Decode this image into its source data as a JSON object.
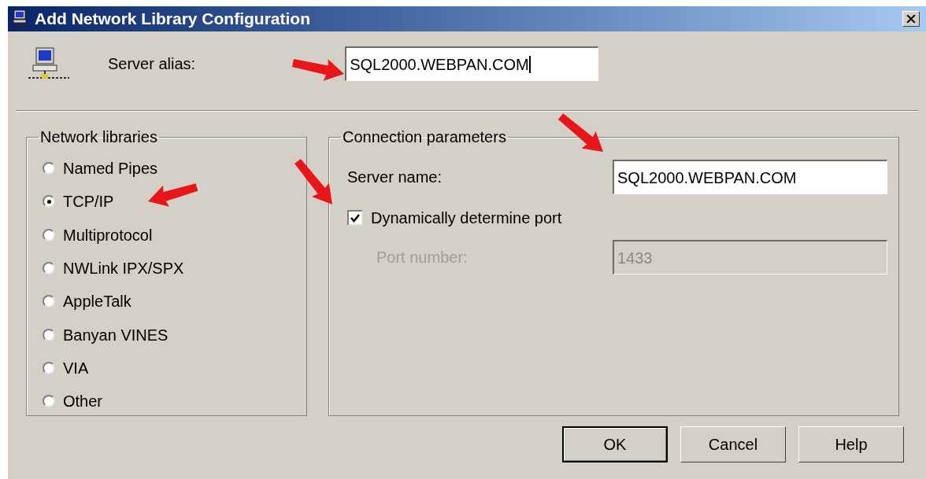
{
  "window": {
    "title": "Add Network Library Configuration"
  },
  "server_alias": {
    "label": "Server alias:",
    "value": "SQL2000.WEBPAN.COM",
    "focused": true
  },
  "network_libraries": {
    "title": "Network libraries",
    "options": [
      {
        "label": "Named Pipes",
        "selected": false
      },
      {
        "label": "TCP/IP",
        "selected": true
      },
      {
        "label": "Multiprotocol",
        "selected": false
      },
      {
        "label": "NWLink IPX/SPX",
        "selected": false
      },
      {
        "label": "AppleTalk",
        "selected": false
      },
      {
        "label": "Banyan VINES",
        "selected": false
      },
      {
        "label": "VIA",
        "selected": false
      },
      {
        "label": "Other",
        "selected": false
      }
    ]
  },
  "connection_parameters": {
    "title": "Connection parameters",
    "server_name": {
      "label": "Server name:",
      "value": "SQL2000.WEBPAN.COM"
    },
    "dynamic_port": {
      "label": "Dynamically determine port",
      "checked": true
    },
    "port_number": {
      "label": "Port number:",
      "value": "1433",
      "disabled": true
    }
  },
  "buttons": [
    {
      "label": "OK",
      "default": true
    },
    {
      "label": "Cancel",
      "default": false
    },
    {
      "label": "Help",
      "default": false
    }
  ]
}
